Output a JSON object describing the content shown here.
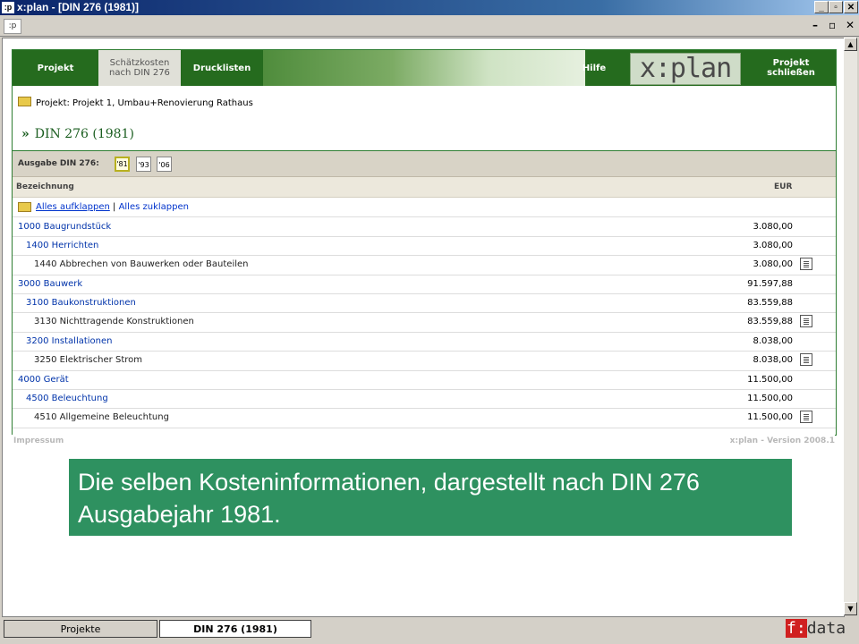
{
  "window": {
    "icon": ":p",
    "title": "x:plan - [DIN 276 (1981)]",
    "controls": [
      "_",
      "▫",
      "✕"
    ]
  },
  "mdi": {
    "icon": ":p",
    "controls": [
      "–",
      "▫",
      "✕"
    ]
  },
  "nav": {
    "items": [
      "Projekt",
      "Schätzkosten nach DIN 276",
      "Drucklisten",
      "Hilfe",
      "Projekt schließen"
    ],
    "logo": "x:plan"
  },
  "project_line": "Projekt: Projekt 1, Umbau+Renovierung Rathaus",
  "heading": {
    "prefix": "»",
    "text": "DIN 276 (1981)"
  },
  "edition": {
    "label": "Ausgabe DIN 276:",
    "buttons": [
      "'81",
      "'93",
      "'06"
    ],
    "selected": "'81"
  },
  "table": {
    "headers": [
      "Bezeichnung",
      "EUR"
    ],
    "expand_all": "Alles aufklappen",
    "separator": "|",
    "collapse_all": "Alles zuklappen",
    "rows": [
      {
        "level": 0,
        "name": "1000 Baugrundstück",
        "amount": "3.080,00"
      },
      {
        "level": 1,
        "name": "1400 Herrichten",
        "amount": "3.080,00"
      },
      {
        "level": 2,
        "name": "1440 Abbrechen von Bauwerken oder Bauteilen",
        "amount": "3.080,00"
      },
      {
        "level": 0,
        "name": "3000 Bauwerk",
        "amount": "91.597,88"
      },
      {
        "level": 1,
        "name": "3100 Baukonstruktionen",
        "amount": "83.559,88"
      },
      {
        "level": 2,
        "name": "3130 Nichttragende Konstruktionen",
        "amount": "83.559,88"
      },
      {
        "level": 1,
        "name": "3200 Installationen",
        "amount": "8.038,00"
      },
      {
        "level": 2,
        "name": "3250 Elektrischer Strom",
        "amount": "8.038,00"
      },
      {
        "level": 0,
        "name": "4000 Gerät",
        "amount": "11.500,00"
      },
      {
        "level": 1,
        "name": "4500 Beleuchtung",
        "amount": "11.500,00"
      },
      {
        "level": 2,
        "name": "4510 Allgemeine Beleuchtung",
        "amount": "11.500,00"
      }
    ]
  },
  "footer": {
    "left": "Impressum",
    "right": "x:plan - Version 2008.1"
  },
  "caption": "Die selben Kosteninformationen, dargestellt nach DIN 276 Ausgabejahr 1981.",
  "tabs": [
    "Projekte",
    "DIN 276 (1981)"
  ],
  "brand": {
    "mark": "f:",
    "text": "data"
  },
  "colors": {
    "nav_green": "#256b1e",
    "caption_green": "#2e9160",
    "link_blue": "#0033aa"
  }
}
